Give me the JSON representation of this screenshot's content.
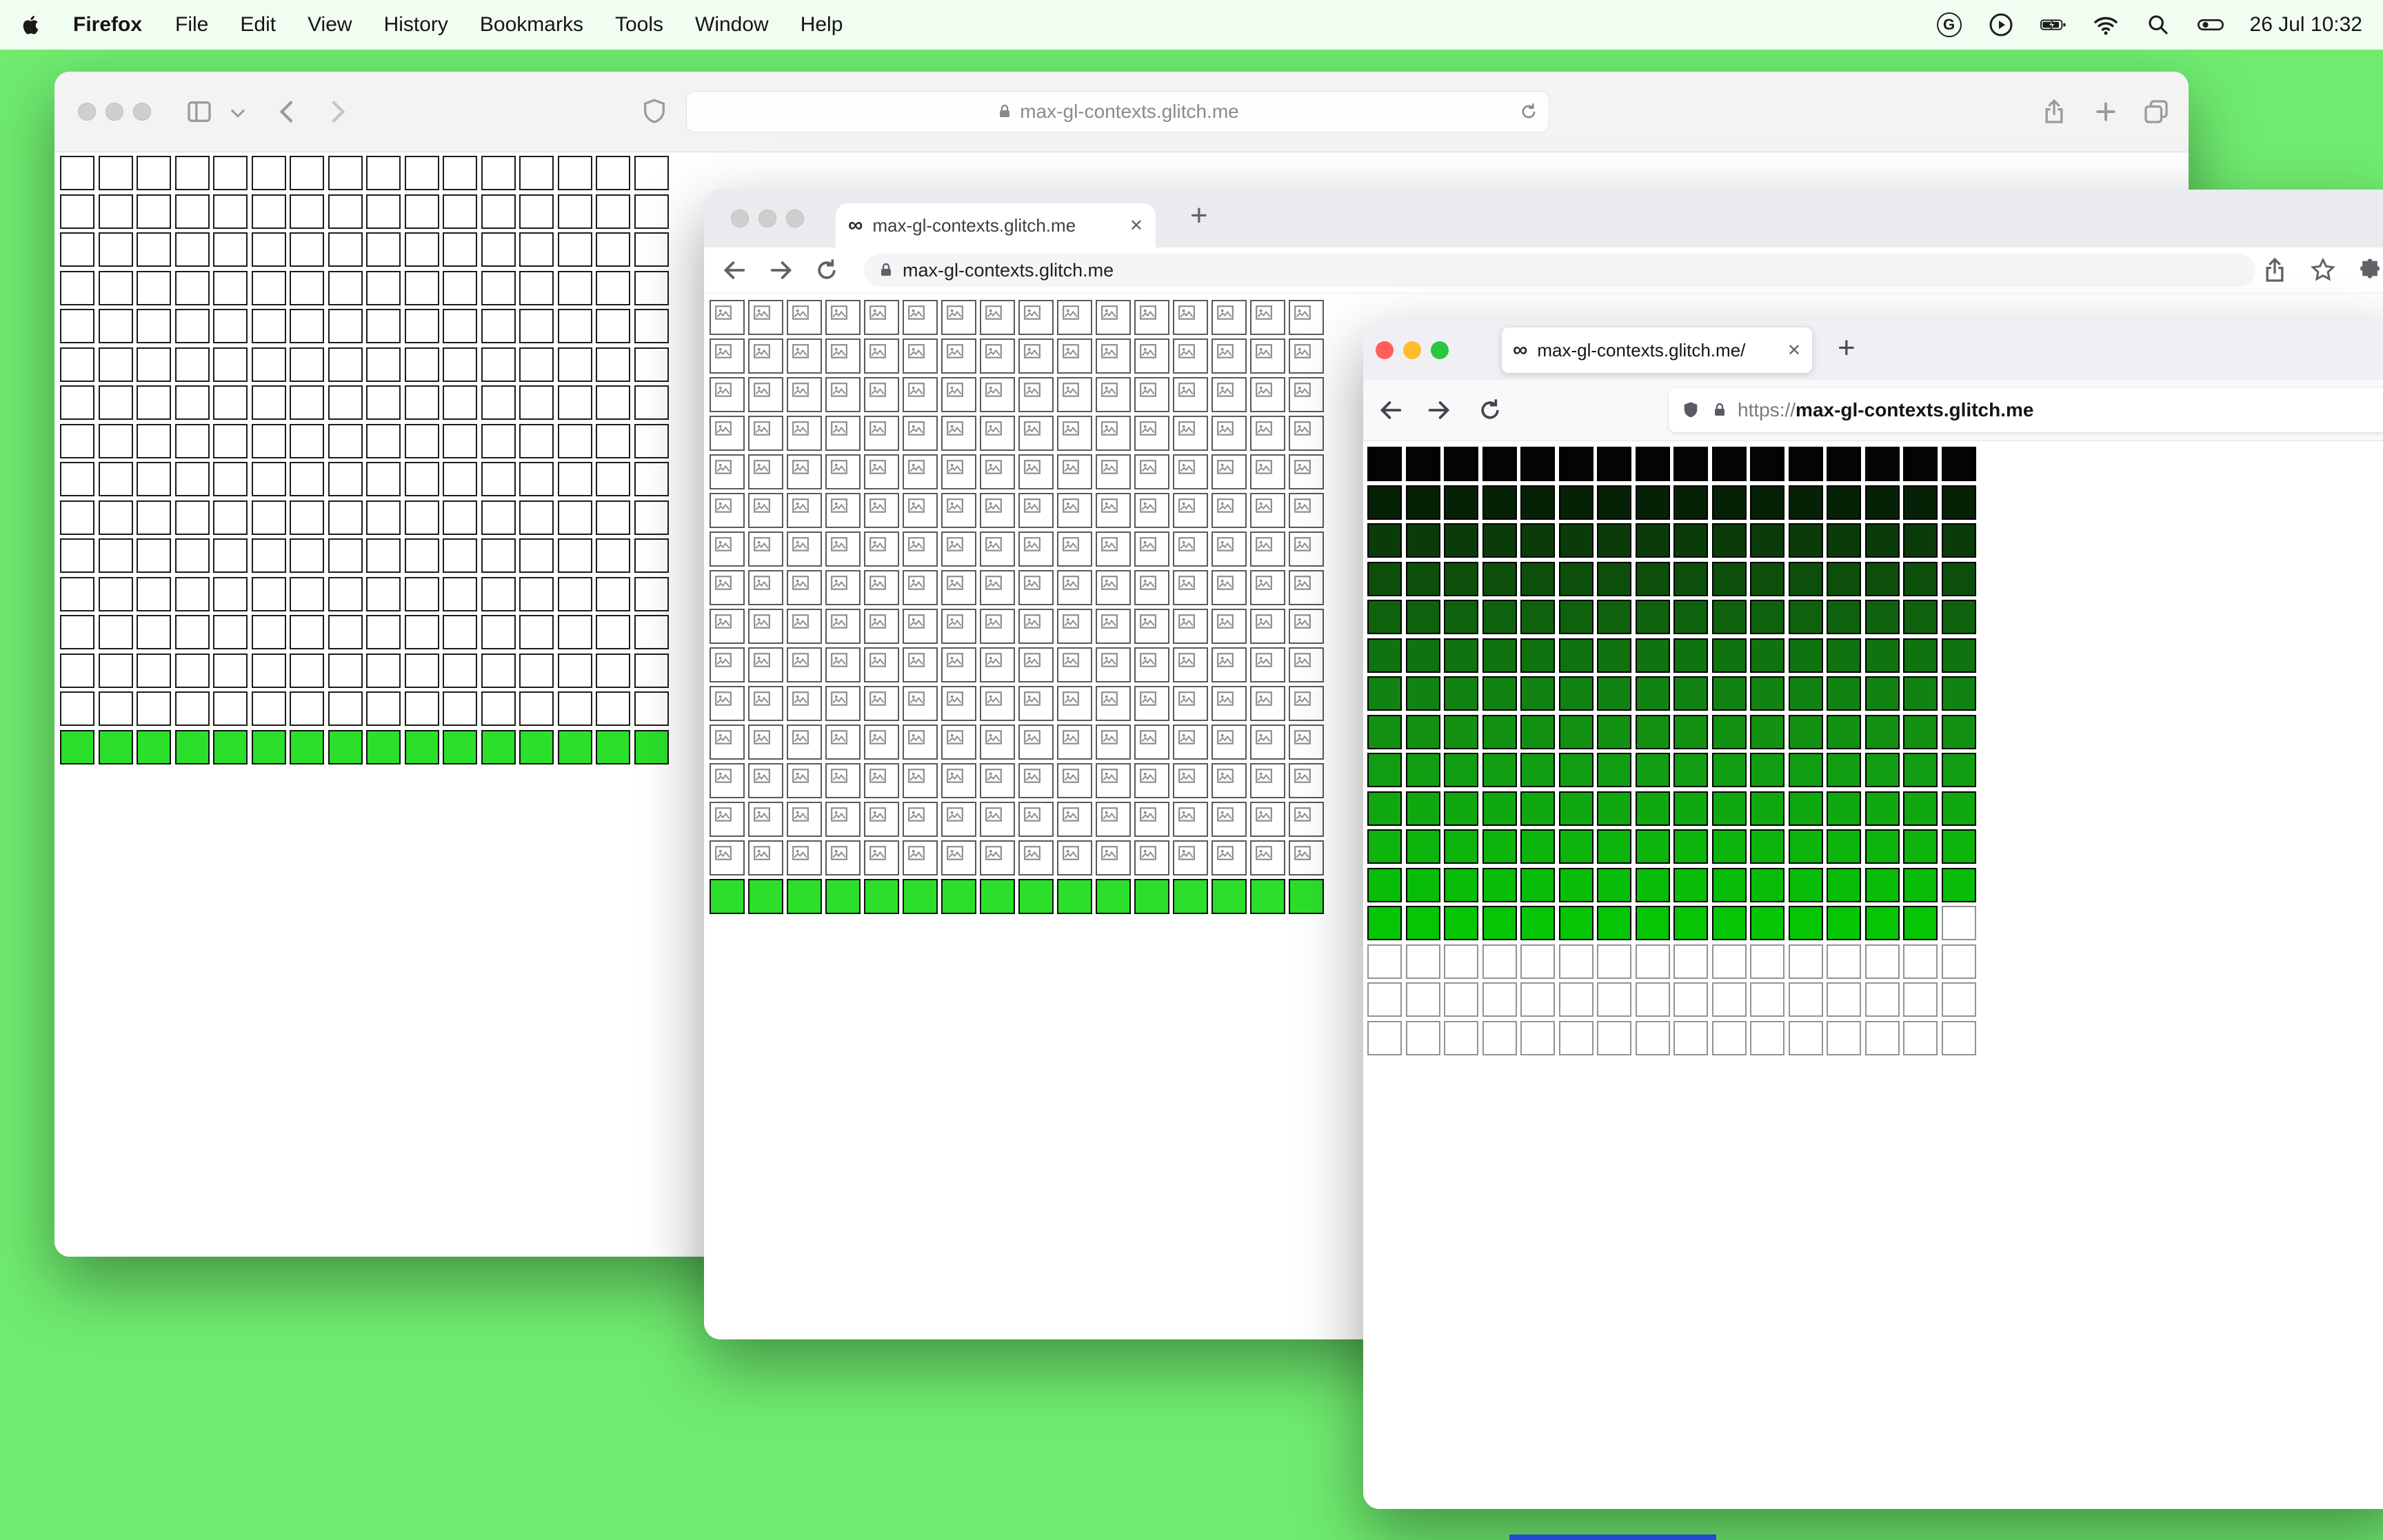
{
  "desktop": {
    "bg_color": "#6fec6f",
    "dock_strip_color": "#2e5bff"
  },
  "menubar": {
    "app_name": "Firefox",
    "menus": [
      "File",
      "Edit",
      "View",
      "History",
      "Bookmarks",
      "Tools",
      "Window",
      "Help"
    ],
    "clock": "26 Jul 10:32",
    "status_icons": [
      "g-circle-icon",
      "play-circle-icon",
      "battery-charging-icon",
      "wifi-icon",
      "spotlight-search-icon",
      "control-center-icon"
    ]
  },
  "glyphs": {
    "infinity": "∞",
    "close": "✕",
    "plus": "+",
    "g_badge": "G"
  },
  "safari_window": {
    "url": "max-gl-contexts.glitch.me",
    "grid": {
      "cols": 16,
      "white_rows": 15,
      "green_rows": 1,
      "green_color": "#2bdf2b",
      "cell_border_color": "#1c1c1c"
    }
  },
  "chrome_window": {
    "tab_title": "max-gl-contexts.glitch.me",
    "url": "max-gl-contexts.glitch.me",
    "grid": {
      "cols": 16,
      "broken_rows": 15,
      "green_rows": 1,
      "green_color": "#2bdf2b"
    }
  },
  "firefox_window": {
    "tab_title": "max-gl-contexts.glitch.me/",
    "url_scheme": "https://",
    "url_host": "max-gl-contexts.glitch.me",
    "grid": {
      "cols": 16,
      "row_colors": [
        "#040404",
        "#062206",
        "#093c09",
        "#0b4f0b",
        "#0e620e",
        "#107310",
        "#128312",
        "#139113",
        "#129e12",
        "#0fa90f",
        "#0cb40c",
        "#08bd08",
        "#05c505"
      ],
      "last_colored_row_cells": 15,
      "empty_rows": 3,
      "empty_cell_border_color": "#939393"
    }
  }
}
